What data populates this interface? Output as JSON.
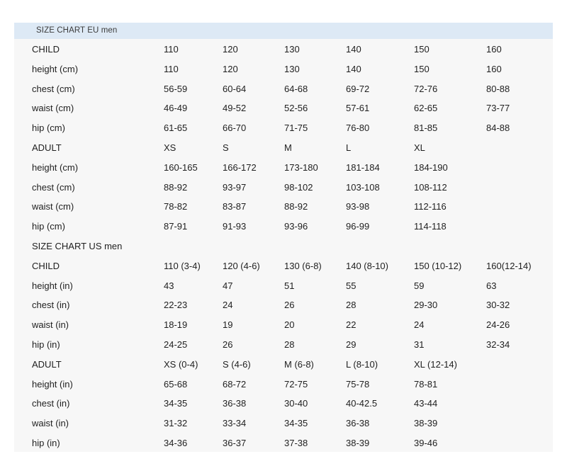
{
  "title": "SIZE CHART EU men",
  "rows": [
    [
      "CHILD",
      "110",
      "120",
      "130",
      "140",
      "150",
      "160"
    ],
    [
      "height (cm)",
      "110",
      "120",
      "130",
      "140",
      "150",
      "160"
    ],
    [
      "chest (cm)",
      "56-59",
      "60-64",
      "64-68",
      "69-72",
      "72-76",
      "80-88"
    ],
    [
      "waist (cm)",
      "46-49",
      "49-52",
      "52-56",
      "57-61",
      "62-65",
      "73-77"
    ],
    [
      "hip (cm)",
      "61-65",
      "66-70",
      "71-75",
      "76-80",
      "81-85",
      "84-88"
    ],
    [
      "ADULT",
      "XS",
      "S",
      "M",
      "L",
      "XL",
      ""
    ],
    [
      "height (cm)",
      "160-165",
      "166-172",
      "173-180",
      "181-184",
      "184-190",
      ""
    ],
    [
      "chest (cm)",
      "88-92",
      "93-97",
      "98-102",
      "103-108",
      "108-112",
      ""
    ],
    [
      "waist (cm)",
      "78-82",
      "83-87",
      "88-92",
      "93-98",
      "112-116",
      ""
    ],
    [
      "hip (cm)",
      "87-91",
      "91-93",
      "93-96",
      "96-99",
      "114-118",
      ""
    ],
    [
      "SIZE CHART US men",
      "",
      "",
      "",
      "",
      "",
      ""
    ],
    [
      "CHILD",
      "110 (3-4)",
      "120 (4-6)",
      "130 (6-8)",
      "140 (8-10)",
      "150 (10-12)",
      "160(12-14)"
    ],
    [
      "height (in)",
      "43",
      "47",
      "51",
      "55",
      "59",
      "63"
    ],
    [
      "chest (in)",
      "22-23",
      "24",
      "26",
      "28",
      "29-30",
      "30-32"
    ],
    [
      "waist (in)",
      "18-19",
      "19",
      "20",
      "22",
      "24",
      "24-26"
    ],
    [
      "hip (in)",
      "24-25",
      "26",
      "28",
      "29",
      "31",
      "32-34"
    ],
    [
      "ADULT",
      "XS (0-4)",
      "S (4-6)",
      "M (6-8)",
      "L (8-10)",
      "XL (12-14)",
      ""
    ],
    [
      "height (in)",
      "65-68",
      "68-72",
      "72-75",
      "75-78",
      "78-81",
      ""
    ],
    [
      "chest (in)",
      "34-35",
      "36-38",
      "30-40",
      "40-42.5",
      "43-44",
      ""
    ],
    [
      "waist (in)",
      "31-32",
      "33-34",
      "34-35",
      "36-38",
      "38-39",
      ""
    ],
    [
      "hip (in)",
      "34-36",
      "36-37",
      "37-38",
      "38-39",
      "39-46",
      ""
    ]
  ]
}
